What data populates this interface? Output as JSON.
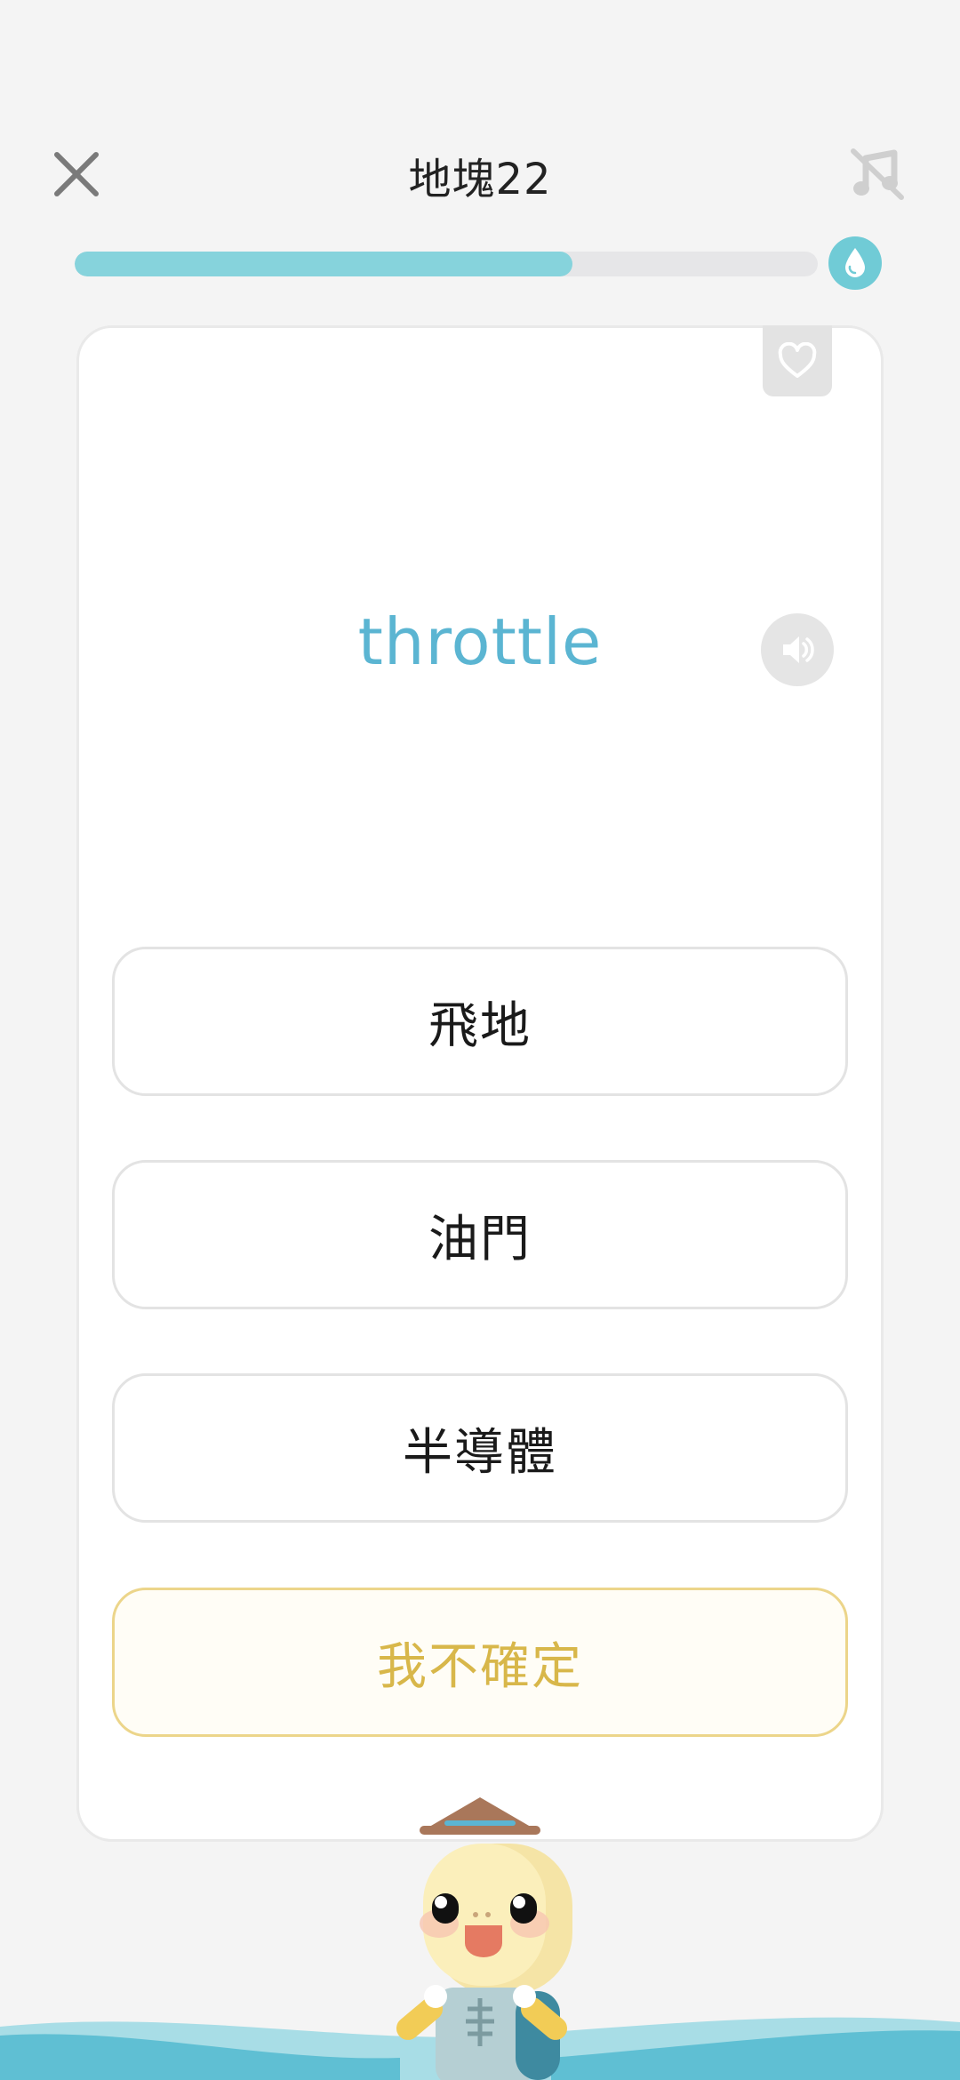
{
  "header": {
    "title": "地塊22",
    "close_icon": "close-icon",
    "music_icon": "music-off-icon"
  },
  "progress": {
    "fraction": 0.67,
    "icon": "water-drop-icon",
    "fill_color": "#86d3dc"
  },
  "card": {
    "word": "throttle",
    "favorite_icon": "heart-icon",
    "speaker_icon": "speaker-icon",
    "word_color": "#5bb5d2"
  },
  "options": [
    {
      "label": "飛地"
    },
    {
      "label": "油門"
    },
    {
      "label": "半導體"
    }
  ],
  "unsure": {
    "label": "我不確定",
    "color": "#d8b74a"
  },
  "mascot": {
    "icon": "mascot-character"
  }
}
